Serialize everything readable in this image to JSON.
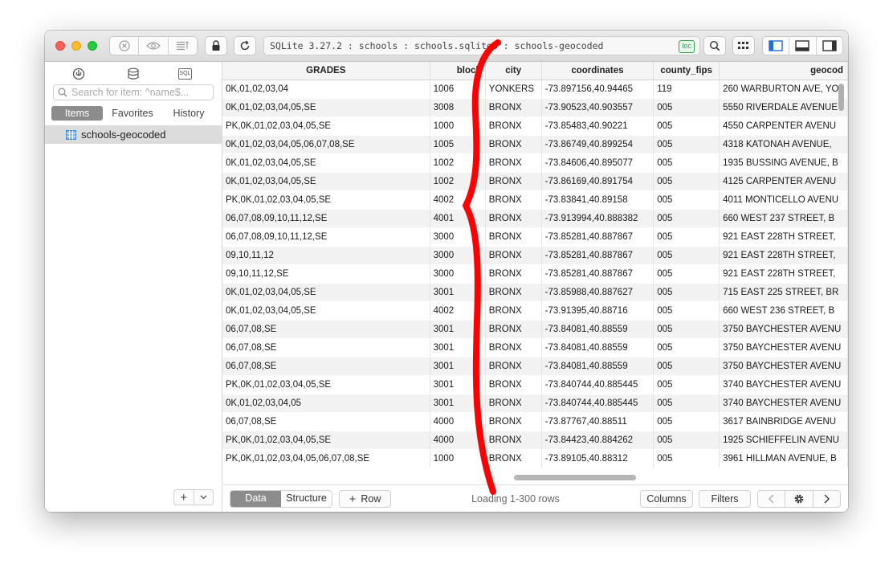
{
  "toolbar": {
    "address": "SQLite 3.27.2 : schools : schools.sqlite3 : schools-geocoded",
    "loc_badge": "loc"
  },
  "sidebar": {
    "search_placeholder": "Search for item: ^name$...",
    "tabs": [
      {
        "label": "Items",
        "active": true
      },
      {
        "label": "Favorites",
        "active": false
      },
      {
        "label": "History",
        "active": false
      }
    ],
    "items": [
      {
        "label": "schools-geocoded"
      }
    ],
    "sql_icon_label": "SQL"
  },
  "table": {
    "columns": [
      "GRADES",
      "block",
      "city",
      "coordinates",
      "county_fips",
      "geocod"
    ],
    "rows": [
      [
        "0K,01,02,03,04",
        "1006",
        "YONKERS",
        "-73.897156,40.94465",
        "119",
        "260 WARBURTON AVE, YO"
      ],
      [
        "0K,01,02,03,04,05,SE",
        "3008",
        "BRONX",
        "-73.90523,40.903557",
        "005",
        "5550 RIVERDALE AVENUE"
      ],
      [
        "PK,0K,01,02,03,04,05,SE",
        "1000",
        "BRONX",
        "-73.85483,40.90221",
        "005",
        "4550 CARPENTER AVENU"
      ],
      [
        "0K,01,02,03,04,05,06,07,08,SE",
        "1005",
        "BRONX",
        "-73.86749,40.899254",
        "005",
        "4318 KATONAH AVENUE,"
      ],
      [
        "0K,01,02,03,04,05,SE",
        "1002",
        "BRONX",
        "-73.84606,40.895077",
        "005",
        "1935 BUSSING AVENUE, B"
      ],
      [
        "0K,01,02,03,04,05,SE",
        "1002",
        "BRONX",
        "-73.86169,40.891754",
        "005",
        "4125 CARPENTER AVENU"
      ],
      [
        "PK,0K,01,02,03,04,05,SE",
        "4002",
        "BRONX",
        "-73.83841,40.89158",
        "005",
        "4011 MONTICELLO AVENU"
      ],
      [
        "06,07,08,09,10,11,12,SE",
        "4001",
        "BRONX",
        "-73.913994,40.888382",
        "005",
        "660 WEST 237 STREET, B"
      ],
      [
        "06,07,08,09,10,11,12,SE",
        "3000",
        "BRONX",
        "-73.85281,40.887867",
        "005",
        "921 EAST 228TH STREET,"
      ],
      [
        "09,10,11,12",
        "3000",
        "BRONX",
        "-73.85281,40.887867",
        "005",
        "921 EAST 228TH STREET,"
      ],
      [
        "09,10,11,12,SE",
        "3000",
        "BRONX",
        "-73.85281,40.887867",
        "005",
        "921 EAST 228TH STREET,"
      ],
      [
        "0K,01,02,03,04,05,SE",
        "3001",
        "BRONX",
        "-73.85988,40.887627",
        "005",
        "715 EAST 225 STREET, BR"
      ],
      [
        "0K,01,02,03,04,05,SE",
        "4002",
        "BRONX",
        "-73.91395,40.88716",
        "005",
        "660 WEST 236 STREET, B"
      ],
      [
        "06,07,08,SE",
        "3001",
        "BRONX",
        "-73.84081,40.88559",
        "005",
        "3750 BAYCHESTER AVENU"
      ],
      [
        "06,07,08,SE",
        "3001",
        "BRONX",
        "-73.84081,40.88559",
        "005",
        "3750 BAYCHESTER AVENU"
      ],
      [
        "06,07,08,SE",
        "3001",
        "BRONX",
        "-73.84081,40.88559",
        "005",
        "3750 BAYCHESTER AVENU"
      ],
      [
        "PK,0K,01,02,03,04,05,SE",
        "3001",
        "BRONX",
        "-73.840744,40.885445",
        "005",
        "3740 BAYCHESTER AVENU"
      ],
      [
        "0K,01,02,03,04,05",
        "3001",
        "BRONX",
        "-73.840744,40.885445",
        "005",
        "3740 BAYCHESTER AVENU"
      ],
      [
        "06,07,08,SE",
        "4000",
        "BRONX",
        "-73.87767,40.88511",
        "005",
        "3617 BAINBRIDGE AVENU"
      ],
      [
        "PK,0K,01,02,03,04,05,SE",
        "4000",
        "BRONX",
        "-73.84423,40.884262",
        "005",
        "1925 SCHIEFFELIN AVENU"
      ],
      [
        "PK,0K,01,02,03,04,05,06,07,08,SE",
        "1000",
        "BRONX",
        "-73.89105,40.88312",
        "005",
        "3961 HILLMAN AVENUE, B"
      ]
    ]
  },
  "bottom": {
    "data_label": "Data",
    "structure_label": "Structure",
    "row_label": "Row",
    "status": "Loading 1-300 rows",
    "columns_label": "Columns",
    "filters_label": "Filters"
  },
  "colors": {
    "annotation_stroke": "#ff0000",
    "selection_blue": "#1f6fd6",
    "loc_green": "#2fa34a"
  }
}
